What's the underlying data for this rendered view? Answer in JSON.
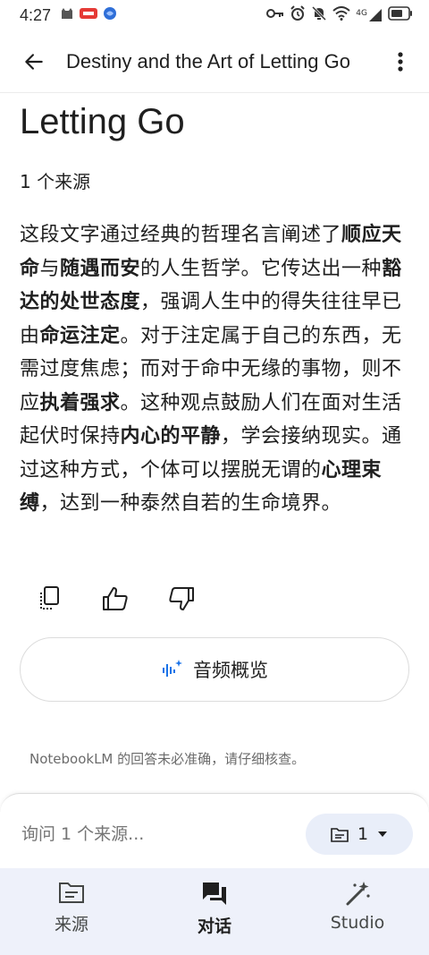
{
  "status_bar": {
    "time": "4:27",
    "network": "4G",
    "icons": [
      "cat-icon",
      "notification-badge-icon",
      "browser-icon",
      "key-icon",
      "alarm-icon",
      "mute-icon",
      "wifi-icon",
      "signal-icon",
      "battery-icon"
    ]
  },
  "app_bar": {
    "title": "Destiny and the Art of Letting Go",
    "back_icon": "arrow-back-icon",
    "more_icon": "more-vert-icon"
  },
  "note": {
    "title": "Letting Go",
    "source_count": "1 个来源",
    "summary_segments": [
      {
        "text": "这段文字通过经典的哲理名言阐述了",
        "bold": false
      },
      {
        "text": "顺应天命",
        "bold": true
      },
      {
        "text": "与",
        "bold": false
      },
      {
        "text": "随遇而安",
        "bold": true
      },
      {
        "text": "的人生哲学。它传达出一种",
        "bold": false
      },
      {
        "text": "豁达的处世态度",
        "bold": true
      },
      {
        "text": "，强调人生中的得失往往早已由",
        "bold": false
      },
      {
        "text": "命运注定",
        "bold": true
      },
      {
        "text": "。对于注定属于自己的东西，无需过度焦虑；而对于命中无缘的事物，则不应",
        "bold": false
      },
      {
        "text": "执着强求",
        "bold": true
      },
      {
        "text": "。这种观点鼓励人们在面对生活起伏时保持",
        "bold": false
      },
      {
        "text": "内心的平静",
        "bold": true
      },
      {
        "text": "，学会接纳现实。通过这种方式，个体可以摆脱无谓的",
        "bold": false
      },
      {
        "text": "心理束缚",
        "bold": true
      },
      {
        "text": "，达到一种泰然自若的生命境界。",
        "bold": false
      }
    ]
  },
  "actions": {
    "copy_icon": "copy-icon",
    "like_icon": "thumb-up-icon",
    "dislike_icon": "thumb-down-icon"
  },
  "audio_overview": {
    "label": "音频概览",
    "icon": "audio-sparkle-icon"
  },
  "disclaimer": "NotebookLM 的回答未必准确，请仔细核查。",
  "chat": {
    "placeholder": "询问 1 个来源...",
    "source_pill_count": "1"
  },
  "bottom_nav": {
    "items": [
      {
        "label": "来源",
        "icon": "sources-icon",
        "active": false
      },
      {
        "label": "对话",
        "icon": "chat-icon",
        "active": true
      },
      {
        "label": "Studio",
        "icon": "magic-wand-icon",
        "active": false
      }
    ]
  },
  "colors": {
    "accent": "#1a73e8",
    "nav_background": "#eef1fa",
    "pill_background": "#e9eef9"
  }
}
